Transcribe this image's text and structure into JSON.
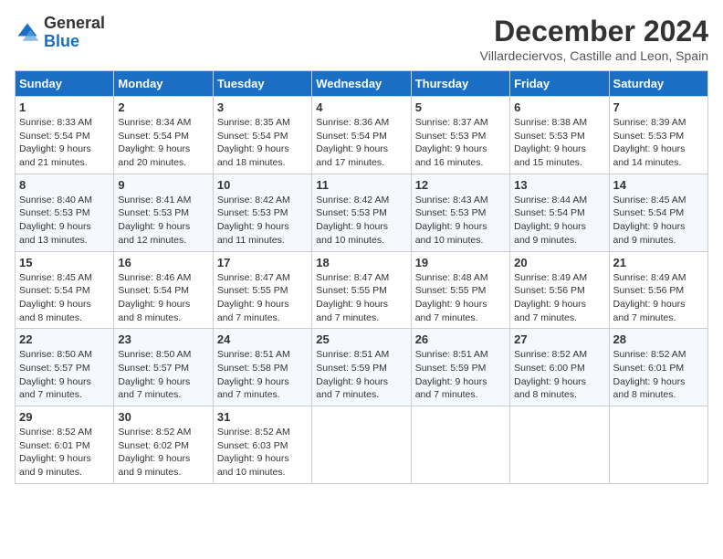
{
  "logo": {
    "general": "General",
    "blue": "Blue"
  },
  "header": {
    "month": "December 2024",
    "location": "Villardeciervos, Castille and Leon, Spain"
  },
  "weekdays": [
    "Sunday",
    "Monday",
    "Tuesday",
    "Wednesday",
    "Thursday",
    "Friday",
    "Saturday"
  ],
  "weeks": [
    [
      {
        "day": "1",
        "info": "Sunrise: 8:33 AM\nSunset: 5:54 PM\nDaylight: 9 hours\nand 21 minutes."
      },
      {
        "day": "2",
        "info": "Sunrise: 8:34 AM\nSunset: 5:54 PM\nDaylight: 9 hours\nand 20 minutes."
      },
      {
        "day": "3",
        "info": "Sunrise: 8:35 AM\nSunset: 5:54 PM\nDaylight: 9 hours\nand 18 minutes."
      },
      {
        "day": "4",
        "info": "Sunrise: 8:36 AM\nSunset: 5:54 PM\nDaylight: 9 hours\nand 17 minutes."
      },
      {
        "day": "5",
        "info": "Sunrise: 8:37 AM\nSunset: 5:53 PM\nDaylight: 9 hours\nand 16 minutes."
      },
      {
        "day": "6",
        "info": "Sunrise: 8:38 AM\nSunset: 5:53 PM\nDaylight: 9 hours\nand 15 minutes."
      },
      {
        "day": "7",
        "info": "Sunrise: 8:39 AM\nSunset: 5:53 PM\nDaylight: 9 hours\nand 14 minutes."
      }
    ],
    [
      {
        "day": "8",
        "info": "Sunrise: 8:40 AM\nSunset: 5:53 PM\nDaylight: 9 hours\nand 13 minutes."
      },
      {
        "day": "9",
        "info": "Sunrise: 8:41 AM\nSunset: 5:53 PM\nDaylight: 9 hours\nand 12 minutes."
      },
      {
        "day": "10",
        "info": "Sunrise: 8:42 AM\nSunset: 5:53 PM\nDaylight: 9 hours\nand 11 minutes."
      },
      {
        "day": "11",
        "info": "Sunrise: 8:42 AM\nSunset: 5:53 PM\nDaylight: 9 hours\nand 10 minutes."
      },
      {
        "day": "12",
        "info": "Sunrise: 8:43 AM\nSunset: 5:53 PM\nDaylight: 9 hours\nand 10 minutes."
      },
      {
        "day": "13",
        "info": "Sunrise: 8:44 AM\nSunset: 5:54 PM\nDaylight: 9 hours\nand 9 minutes."
      },
      {
        "day": "14",
        "info": "Sunrise: 8:45 AM\nSunset: 5:54 PM\nDaylight: 9 hours\nand 9 minutes."
      }
    ],
    [
      {
        "day": "15",
        "info": "Sunrise: 8:45 AM\nSunset: 5:54 PM\nDaylight: 9 hours\nand 8 minutes."
      },
      {
        "day": "16",
        "info": "Sunrise: 8:46 AM\nSunset: 5:54 PM\nDaylight: 9 hours\nand 8 minutes."
      },
      {
        "day": "17",
        "info": "Sunrise: 8:47 AM\nSunset: 5:55 PM\nDaylight: 9 hours\nand 7 minutes."
      },
      {
        "day": "18",
        "info": "Sunrise: 8:47 AM\nSunset: 5:55 PM\nDaylight: 9 hours\nand 7 minutes."
      },
      {
        "day": "19",
        "info": "Sunrise: 8:48 AM\nSunset: 5:55 PM\nDaylight: 9 hours\nand 7 minutes."
      },
      {
        "day": "20",
        "info": "Sunrise: 8:49 AM\nSunset: 5:56 PM\nDaylight: 9 hours\nand 7 minutes."
      },
      {
        "day": "21",
        "info": "Sunrise: 8:49 AM\nSunset: 5:56 PM\nDaylight: 9 hours\nand 7 minutes."
      }
    ],
    [
      {
        "day": "22",
        "info": "Sunrise: 8:50 AM\nSunset: 5:57 PM\nDaylight: 9 hours\nand 7 minutes."
      },
      {
        "day": "23",
        "info": "Sunrise: 8:50 AM\nSunset: 5:57 PM\nDaylight: 9 hours\nand 7 minutes."
      },
      {
        "day": "24",
        "info": "Sunrise: 8:51 AM\nSunset: 5:58 PM\nDaylight: 9 hours\nand 7 minutes."
      },
      {
        "day": "25",
        "info": "Sunrise: 8:51 AM\nSunset: 5:59 PM\nDaylight: 9 hours\nand 7 minutes."
      },
      {
        "day": "26",
        "info": "Sunrise: 8:51 AM\nSunset: 5:59 PM\nDaylight: 9 hours\nand 7 minutes."
      },
      {
        "day": "27",
        "info": "Sunrise: 8:52 AM\nSunset: 6:00 PM\nDaylight: 9 hours\nand 8 minutes."
      },
      {
        "day": "28",
        "info": "Sunrise: 8:52 AM\nSunset: 6:01 PM\nDaylight: 9 hours\nand 8 minutes."
      }
    ],
    [
      {
        "day": "29",
        "info": "Sunrise: 8:52 AM\nSunset: 6:01 PM\nDaylight: 9 hours\nand 9 minutes."
      },
      {
        "day": "30",
        "info": "Sunrise: 8:52 AM\nSunset: 6:02 PM\nDaylight: 9 hours\nand 9 minutes."
      },
      {
        "day": "31",
        "info": "Sunrise: 8:52 AM\nSunset: 6:03 PM\nDaylight: 9 hours\nand 10 minutes."
      },
      {
        "day": "",
        "info": ""
      },
      {
        "day": "",
        "info": ""
      },
      {
        "day": "",
        "info": ""
      },
      {
        "day": "",
        "info": ""
      }
    ]
  ]
}
